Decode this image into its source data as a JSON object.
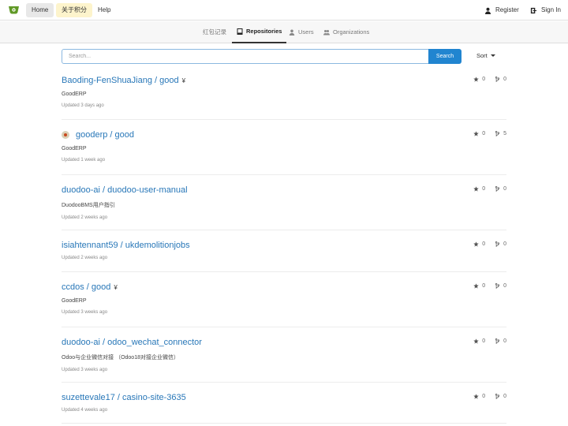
{
  "nav": {
    "logo": "gitea-logo-icon",
    "home_label": "Home",
    "points_label": "关于积分",
    "help_label": "Help",
    "register_label": "Register",
    "signin_label": "Sign In",
    "brand_color": "#609926"
  },
  "tabs": {
    "redpack_label": "红包记录",
    "repos_label": "Repositories",
    "users_label": "Users",
    "orgs_label": "Organizations"
  },
  "search": {
    "placeholder": "Search...",
    "button_label": "Search",
    "sort_label": "Sort",
    "accent_color": "#2185d0"
  },
  "repos": [
    {
      "title": "Baoding-FenShuaJiang / good",
      "fork": "¥",
      "description": "GoodERP",
      "updated": "Updated 3 days ago",
      "stars": "0",
      "forks": "0"
    },
    {
      "title": "gooderp / good",
      "avatar": "gooderp-avatar-icon",
      "description": "GoodERP",
      "updated": "Updated 1 week ago",
      "stars": "0",
      "forks": "5"
    },
    {
      "title": "duodoo-ai / duodoo-user-manual",
      "description": "DuodooBMS用户指引",
      "updated": "Updated 2 weeks ago",
      "stars": "0",
      "forks": "0"
    },
    {
      "title": "isiahtennant59 / ukdemolitionjobs",
      "updated": "Updated 2 weeks ago",
      "stars": "0",
      "forks": "0"
    },
    {
      "title": "ccdos / good",
      "fork": "¥",
      "description": "GoodERP",
      "updated": "Updated 3 weeks ago",
      "stars": "0",
      "forks": "0"
    },
    {
      "title": "duodoo-ai / odoo_wechat_connector",
      "description": "Odoo与企业微信对接 （Odoo18对接企业微信）",
      "updated": "Updated 3 weeks ago",
      "stars": "0",
      "forks": "0"
    },
    {
      "title": "suzettevale17 / casino-site-3635",
      "updated": "Updated 4 weeks ago",
      "stars": "0",
      "forks": "0"
    }
  ]
}
